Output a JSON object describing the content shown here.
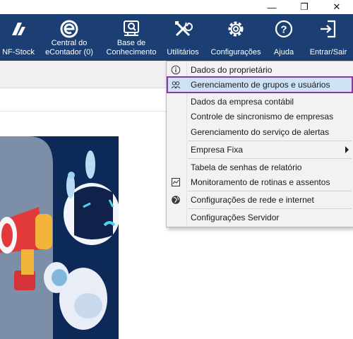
{
  "window": {
    "minimize_glyph": "—",
    "restore_glyph": "❐",
    "close_glyph": "✕"
  },
  "toolbar": {
    "items": [
      {
        "label": "NF-Stock",
        "icon": "nf-stock-logo-icon"
      },
      {
        "label": "Central do eContador (0)",
        "icon": "econtador-e-icon"
      },
      {
        "label": "Base de Conhecimento",
        "icon": "knowledge-search-icon"
      },
      {
        "label": "Utilitários",
        "icon": "tools-icon"
      },
      {
        "label": "Configurações",
        "icon": "gear-icon"
      },
      {
        "label": "Ajuda",
        "icon": "help-icon"
      },
      {
        "label": "Entrar/Sair",
        "icon": "login-icon"
      }
    ],
    "label_central_1": "Central do",
    "label_central_2": "eContador (0)",
    "label_base_1": "Base de",
    "label_base_2": "Conhecimento"
  },
  "menu": {
    "items": [
      {
        "label": "Dados do proprietário",
        "icon": "info-icon"
      },
      {
        "label": "Gerenciamento de grupos e usuários",
        "icon": "users-icon",
        "highlighted": true
      },
      {
        "label": "Dados da empresa contábil"
      },
      {
        "label": "Controle de sincronismo de empresas"
      },
      {
        "label": "Gerenciamento do serviço de alertas"
      },
      {
        "label": "Empresa Fixa",
        "submenu": true
      },
      {
        "label": "Tabela de senhas de relatório"
      },
      {
        "label": "Monitoramento de rotinas e assentos",
        "icon": "monitor-chart-icon"
      },
      {
        "label": "Configurações de rede e internet",
        "icon": "globe-icon"
      },
      {
        "label": "Configurações Servidor"
      }
    ]
  },
  "colors": {
    "toolbar_bg": "#1b3f73",
    "menu_highlight": "#cde3f5",
    "highlight_border": "#8a3a9e",
    "banner_bg": "#0d2957"
  }
}
